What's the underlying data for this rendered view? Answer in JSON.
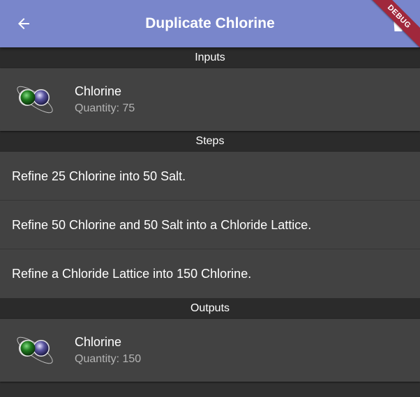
{
  "appbar": {
    "title": "Duplicate Chlorine",
    "back_icon": "arrow-back-icon",
    "action_icon": "delete-icon",
    "color": "#7986CB"
  },
  "debug_banner": {
    "label": "DEBUG",
    "color": "#A0283C"
  },
  "inputs": {
    "header": "Inputs",
    "items": [
      {
        "name": "Chlorine",
        "quantity": "Quantity: 75",
        "icon": "chlorine-molecule-icon"
      }
    ]
  },
  "steps": {
    "header": "Steps",
    "items": [
      "Refine 25 Chlorine into 50 Salt.",
      "Refine 50 Chlorine and 50 Salt into a Chloride Lattice.",
      "Refine a Chloride Lattice into 150 Chlorine."
    ]
  },
  "outputs": {
    "header": "Outputs",
    "items": [
      {
        "name": "Chlorine",
        "quantity": "Quantity: 150",
        "icon": "chlorine-molecule-icon"
      }
    ]
  }
}
